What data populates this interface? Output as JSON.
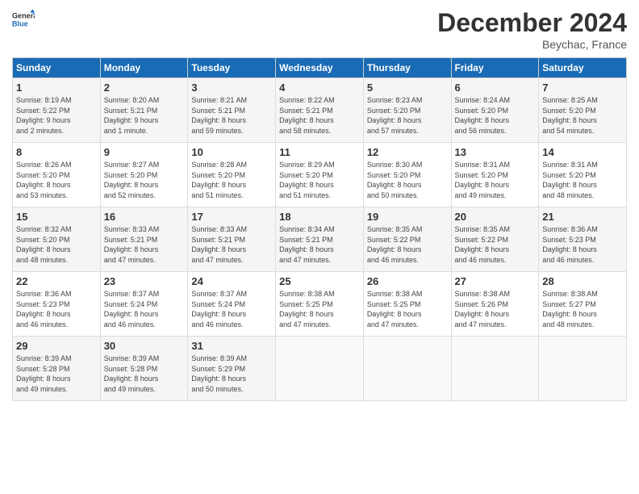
{
  "header": {
    "logo_general": "General",
    "logo_blue": "Blue",
    "title": "December 2024",
    "location": "Beychac, France"
  },
  "days_of_week": [
    "Sunday",
    "Monday",
    "Tuesday",
    "Wednesday",
    "Thursday",
    "Friday",
    "Saturday"
  ],
  "weeks": [
    [
      {
        "day": "1",
        "sunrise": "8:19 AM",
        "sunset": "5:22 PM",
        "daylight": "9 hours and 2 minutes."
      },
      {
        "day": "2",
        "sunrise": "8:20 AM",
        "sunset": "5:21 PM",
        "daylight": "9 hours and 1 minute."
      },
      {
        "day": "3",
        "sunrise": "8:21 AM",
        "sunset": "5:21 PM",
        "daylight": "8 hours and 59 minutes."
      },
      {
        "day": "4",
        "sunrise": "8:22 AM",
        "sunset": "5:21 PM",
        "daylight": "8 hours and 58 minutes."
      },
      {
        "day": "5",
        "sunrise": "8:23 AM",
        "sunset": "5:20 PM",
        "daylight": "8 hours and 57 minutes."
      },
      {
        "day": "6",
        "sunrise": "8:24 AM",
        "sunset": "5:20 PM",
        "daylight": "8 hours and 56 minutes."
      },
      {
        "day": "7",
        "sunrise": "8:25 AM",
        "sunset": "5:20 PM",
        "daylight": "8 hours and 54 minutes."
      }
    ],
    [
      {
        "day": "8",
        "sunrise": "8:26 AM",
        "sunset": "5:20 PM",
        "daylight": "8 hours and 53 minutes."
      },
      {
        "day": "9",
        "sunrise": "8:27 AM",
        "sunset": "5:20 PM",
        "daylight": "8 hours and 52 minutes."
      },
      {
        "day": "10",
        "sunrise": "8:28 AM",
        "sunset": "5:20 PM",
        "daylight": "8 hours and 51 minutes."
      },
      {
        "day": "11",
        "sunrise": "8:29 AM",
        "sunset": "5:20 PM",
        "daylight": "8 hours and 51 minutes."
      },
      {
        "day": "12",
        "sunrise": "8:30 AM",
        "sunset": "5:20 PM",
        "daylight": "8 hours and 50 minutes."
      },
      {
        "day": "13",
        "sunrise": "8:31 AM",
        "sunset": "5:20 PM",
        "daylight": "8 hours and 49 minutes."
      },
      {
        "day": "14",
        "sunrise": "8:31 AM",
        "sunset": "5:20 PM",
        "daylight": "8 hours and 48 minutes."
      }
    ],
    [
      {
        "day": "15",
        "sunrise": "8:32 AM",
        "sunset": "5:20 PM",
        "daylight": "8 hours and 48 minutes."
      },
      {
        "day": "16",
        "sunrise": "8:33 AM",
        "sunset": "5:21 PM",
        "daylight": "8 hours and 47 minutes."
      },
      {
        "day": "17",
        "sunrise": "8:33 AM",
        "sunset": "5:21 PM",
        "daylight": "8 hours and 47 minutes."
      },
      {
        "day": "18",
        "sunrise": "8:34 AM",
        "sunset": "5:21 PM",
        "daylight": "8 hours and 47 minutes."
      },
      {
        "day": "19",
        "sunrise": "8:35 AM",
        "sunset": "5:22 PM",
        "daylight": "8 hours and 46 minutes."
      },
      {
        "day": "20",
        "sunrise": "8:35 AM",
        "sunset": "5:22 PM",
        "daylight": "8 hours and 46 minutes."
      },
      {
        "day": "21",
        "sunrise": "8:36 AM",
        "sunset": "5:23 PM",
        "daylight": "8 hours and 46 minutes."
      }
    ],
    [
      {
        "day": "22",
        "sunrise": "8:36 AM",
        "sunset": "5:23 PM",
        "daylight": "8 hours and 46 minutes."
      },
      {
        "day": "23",
        "sunrise": "8:37 AM",
        "sunset": "5:24 PM",
        "daylight": "8 hours and 46 minutes."
      },
      {
        "day": "24",
        "sunrise": "8:37 AM",
        "sunset": "5:24 PM",
        "daylight": "8 hours and 46 minutes."
      },
      {
        "day": "25",
        "sunrise": "8:38 AM",
        "sunset": "5:25 PM",
        "daylight": "8 hours and 47 minutes."
      },
      {
        "day": "26",
        "sunrise": "8:38 AM",
        "sunset": "5:25 PM",
        "daylight": "8 hours and 47 minutes."
      },
      {
        "day": "27",
        "sunrise": "8:38 AM",
        "sunset": "5:26 PM",
        "daylight": "8 hours and 47 minutes."
      },
      {
        "day": "28",
        "sunrise": "8:38 AM",
        "sunset": "5:27 PM",
        "daylight": "8 hours and 48 minutes."
      }
    ],
    [
      {
        "day": "29",
        "sunrise": "8:39 AM",
        "sunset": "5:28 PM",
        "daylight": "8 hours and 49 minutes."
      },
      {
        "day": "30",
        "sunrise": "8:39 AM",
        "sunset": "5:28 PM",
        "daylight": "8 hours and 49 minutes."
      },
      {
        "day": "31",
        "sunrise": "8:39 AM",
        "sunset": "5:29 PM",
        "daylight": "8 hours and 50 minutes."
      },
      null,
      null,
      null,
      null
    ]
  ]
}
